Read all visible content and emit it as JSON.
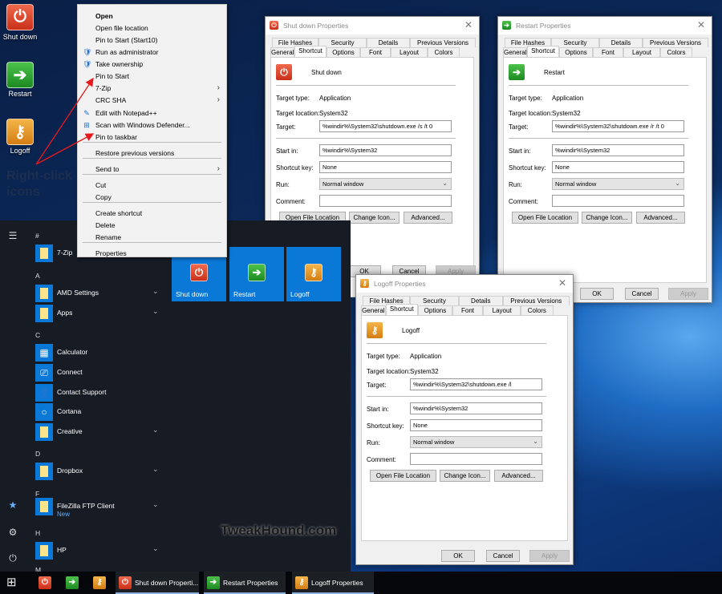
{
  "desktop": {
    "icons": [
      {
        "label": "Shut down",
        "icon": "power-icon"
      },
      {
        "label": "Restart",
        "icon": "arrow-right-icon"
      },
      {
        "label": "Logoff",
        "icon": "key-icon"
      }
    ],
    "hint": "Right-click icons",
    "arrow_color": "#e8191c"
  },
  "context_menu": {
    "items": [
      "Open",
      "Open file location",
      "Pin to Start (Start10)",
      "Run as administrator",
      "Take ownership",
      "Pin to Start",
      "7-Zip",
      "CRC SHA",
      "Edit with Notepad++",
      "Scan with Windows Defender...",
      "Pin to taskbar",
      "Restore previous versions",
      "Send to",
      "Cut",
      "Copy",
      "Create shortcut",
      "Delete",
      "Rename",
      "Properties"
    ]
  },
  "start_menu": {
    "headers": [
      "#",
      "A",
      "C",
      "D",
      "F",
      "H",
      "M"
    ],
    "apps": [
      {
        "name": "7-Zip"
      },
      {
        "name": "AMD Settings"
      },
      {
        "name": "Apps"
      },
      {
        "name": "Calculator"
      },
      {
        "name": "Connect"
      },
      {
        "name": "Contact Support"
      },
      {
        "name": "Cortana"
      },
      {
        "name": "Creative"
      },
      {
        "name": "Dropbox"
      },
      {
        "name": "FileZilla FTP Client",
        "badge": "New"
      },
      {
        "name": "HP"
      }
    ],
    "tiles": [
      {
        "label": "Shut down"
      },
      {
        "label": "Restart"
      },
      {
        "label": "Logoff"
      }
    ],
    "accent": "#0a78d7"
  },
  "watermark": "TweakHound.com",
  "dialogs": [
    {
      "title": "Shut down Properties",
      "name": "Shut down",
      "target": "%windir%\\System32\\shutdown.exe /s /t 0"
    },
    {
      "title": "Restart Properties",
      "name": "Restart",
      "target": "%windir%\\System32\\shutdown.exe /r /t 0"
    },
    {
      "title": "Logoff Properties",
      "name": "Logoff",
      "target": "%windir%\\System32\\shutdown.exe /l"
    }
  ],
  "dialog_common": {
    "tabs_row1": [
      "File Hashes",
      "Security",
      "Details",
      "Previous Versions"
    ],
    "tabs_row2": [
      "General",
      "Shortcut",
      "Options",
      "Font",
      "Layout",
      "Colors"
    ],
    "target_type_label": "Target type:",
    "target_type": "Application",
    "target_location_label": "Target location:",
    "target_location": "System32",
    "target_label": "Target:",
    "start_in_label": "Start in:",
    "start_in": "%windir%\\System32",
    "shortcut_key_label": "Shortcut key:",
    "shortcut_key": "None",
    "run_label": "Run:",
    "run": "Normal window",
    "comment_label": "Comment:",
    "comment": "",
    "open_file_location": "Open File Location",
    "change_icon": "Change Icon...",
    "advanced": "Advanced...",
    "ok": "OK",
    "cancel": "Cancel",
    "apply": "Apply"
  },
  "taskbar": {
    "buttons": [
      "Shut down Properti...",
      "Restart Properties",
      "Logoff Properties"
    ]
  }
}
